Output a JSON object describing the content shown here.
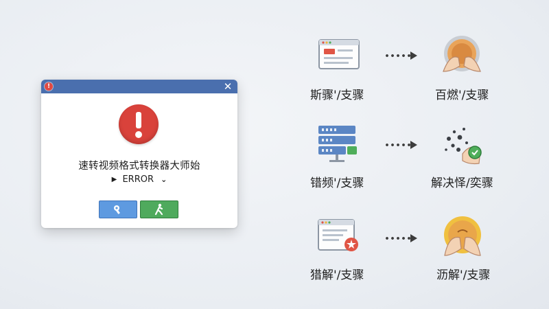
{
  "dialog": {
    "message": "速转视频格式转换器大师始",
    "error_label": "ERROR",
    "caret_glyph": "▶",
    "chevron_glyph": "⌄",
    "close_glyph": "✕",
    "titlebar_color": "#4a6fae",
    "error_icon_color": "#d9423b",
    "buttons": [
      {
        "name": "blue-action-button",
        "color": "#5e9ae0",
        "icon": "wrench-icon"
      },
      {
        "name": "green-action-button",
        "color": "#4faa5d",
        "icon": "run-icon"
      }
    ]
  },
  "steps": [
    {
      "left_label": "斯骤'/支骤",
      "right_label": "百燃'/支骤",
      "left_icon": "browser-window-icon",
      "right_icon": "hands-covering-face-icon"
    },
    {
      "left_label": "错频'/支骤",
      "right_label": "解决怿/奕骤",
      "left_icon": "server-stack-icon",
      "right_icon": "fix-scatter-icon"
    },
    {
      "left_label": "猎解'/支骤",
      "right_label": "沥解'/支骤",
      "left_icon": "window-with-error-icon",
      "right_icon": "hands-over-coin-icon"
    }
  ]
}
